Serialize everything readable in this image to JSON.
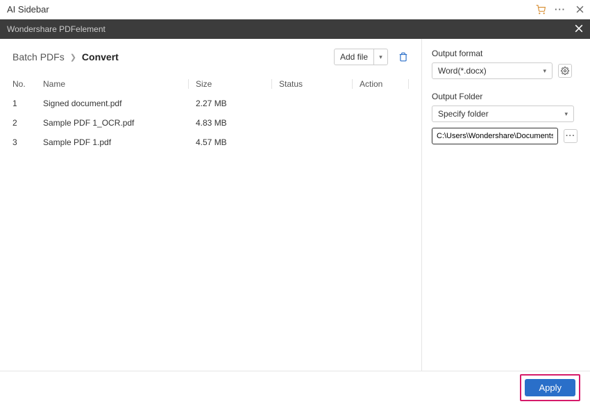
{
  "top": {
    "title": "AI Sidebar"
  },
  "darkbar": {
    "title": "Wondershare PDFelement"
  },
  "breadcrumb": {
    "root": "Batch PDFs",
    "current": "Convert"
  },
  "toolbar": {
    "addfile_label": "Add file"
  },
  "columns": {
    "no": "No.",
    "name": "Name",
    "size": "Size",
    "status": "Status",
    "action": "Action"
  },
  "files": [
    {
      "no": "1",
      "name": "Signed document.pdf",
      "size": "2.27 MB"
    },
    {
      "no": "2",
      "name": "Sample PDF 1_OCR.pdf",
      "size": "4.83 MB"
    },
    {
      "no": "3",
      "name": "Sample PDF 1.pdf",
      "size": "4.57 MB"
    }
  ],
  "right": {
    "output_format_label": "Output format",
    "output_format_value": "Word(*.docx)",
    "output_folder_label": "Output Folder",
    "output_folder_value": "Specify folder",
    "path": "C:\\Users\\Wondershare\\Documents\\"
  },
  "footer": {
    "apply": "Apply"
  }
}
